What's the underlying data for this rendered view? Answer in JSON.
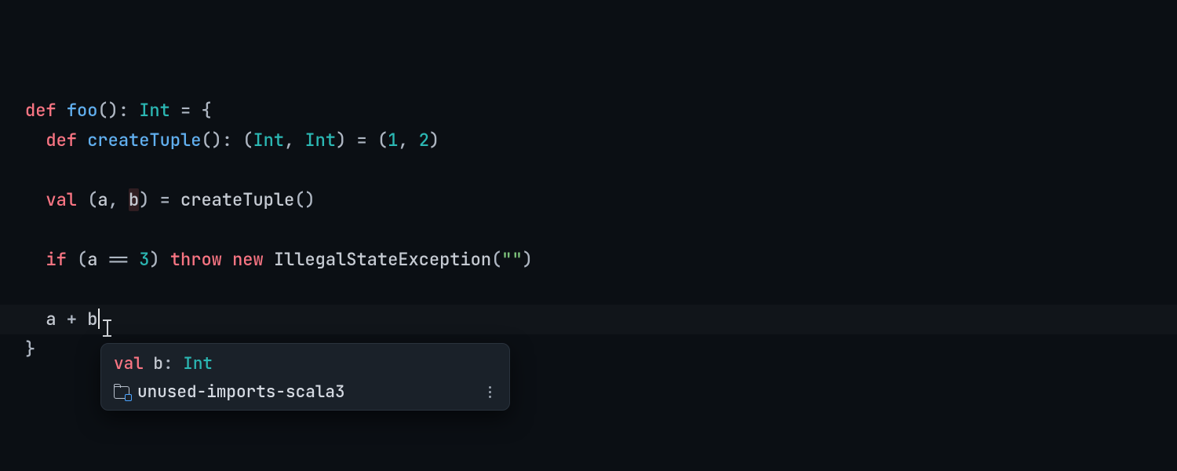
{
  "colors": {
    "background": "#0b0f14",
    "keyword": "#f97583",
    "function": "#61afef",
    "type": "#2bb7b3",
    "number": "#2bb7b3",
    "string": "#7cc17a",
    "default": "#c6cbd3",
    "tooltip_bg": "#1a2129",
    "tooltip_border": "#2a333d"
  },
  "code": {
    "l1": {
      "def": "def",
      "sp1": " ",
      "name": "foo",
      "paren": "()",
      "colon": ": ",
      "ret": "Int",
      "eq": " = {",
      "close": ""
    },
    "l2": {
      "indent": "  ",
      "def": "def",
      "sp1": " ",
      "name": "createTuple",
      "paren": "()",
      "colon": ": (",
      "t1": "Int",
      "comma": ", ",
      "t2": "Int",
      "close": ") = (",
      "n1": "1",
      "c2": ", ",
      "n2": "2",
      "rp": ")"
    },
    "l3": {
      "blank": ""
    },
    "l4": {
      "indent": "  ",
      "val": "val",
      "sp": " (",
      "a": "a",
      "c": ", ",
      "b": "b",
      "rp": ") = ",
      "call": "createTuple",
      "par": "()"
    },
    "l5": {
      "blank": ""
    },
    "l6": {
      "indent": "  ",
      "if": "if",
      "sp": " (",
      "a": "a",
      "eq": " == ",
      "n": "3",
      "rp": ") ",
      "throw": "throw",
      "sp2": " ",
      "new": "new",
      "sp3": " ",
      "ex": "IllegalStateException",
      "lp2": "(",
      "str": "\"\"",
      "rp2": ")"
    },
    "l7": {
      "blank": ""
    },
    "l8": {
      "indent": "  ",
      "a": "a",
      "op": " + ",
      "b": "b"
    },
    "l9": {
      "close": "}"
    }
  },
  "tooltip": {
    "header": {
      "kw": "val",
      "sp": " ",
      "name": "b",
      "colon": ": ",
      "type": "Int"
    },
    "item_label": "unused-imports-scala3"
  },
  "icons": {
    "text_cursor": "text-cursor-icon",
    "folder": "folder-icon",
    "more": "vertical-dots-icon"
  }
}
